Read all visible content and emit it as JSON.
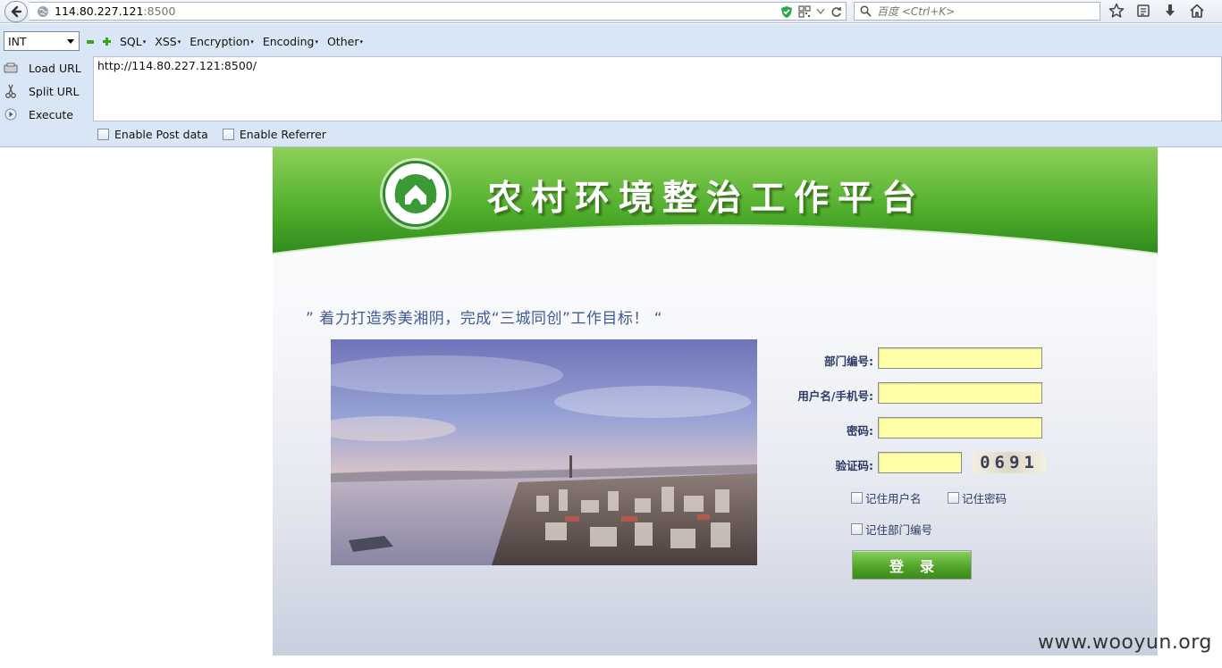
{
  "browser": {
    "url_host": "114.80.227.121",
    "url_port": ":8500",
    "search_placeholder": "百度 <Ctrl+K>"
  },
  "hackbar": {
    "select_value": "INT",
    "menus": [
      "SQL",
      "XSS",
      "Encryption",
      "Encoding",
      "Other"
    ],
    "load_url": "Load URL",
    "split_url": "Split URL",
    "execute": "Execute",
    "url_value": "http://114.80.227.121:8500/",
    "enable_post": "Enable Post data",
    "enable_referrer": "Enable Referrer"
  },
  "page": {
    "banner_title": "农村环境整治工作平台",
    "slogan": "” 着力打造秀美湘阴，完成“三城同创”工作目标！ “",
    "form": {
      "dept_label": "部门编号:",
      "user_label": "用户名/手机号:",
      "password_label": "密码:",
      "captcha_label": "验证码:",
      "captcha_value": "0691",
      "remember_user": "记住用户名",
      "remember_password": "记住密码",
      "remember_dept": "记住部门编号",
      "login_button": "登录"
    }
  },
  "watermark": "www.wooyun.org",
  "colors": {
    "banner_green": "#5fb838",
    "input_yellow": "#ffffa8",
    "label_blue": "#2b3a66"
  }
}
